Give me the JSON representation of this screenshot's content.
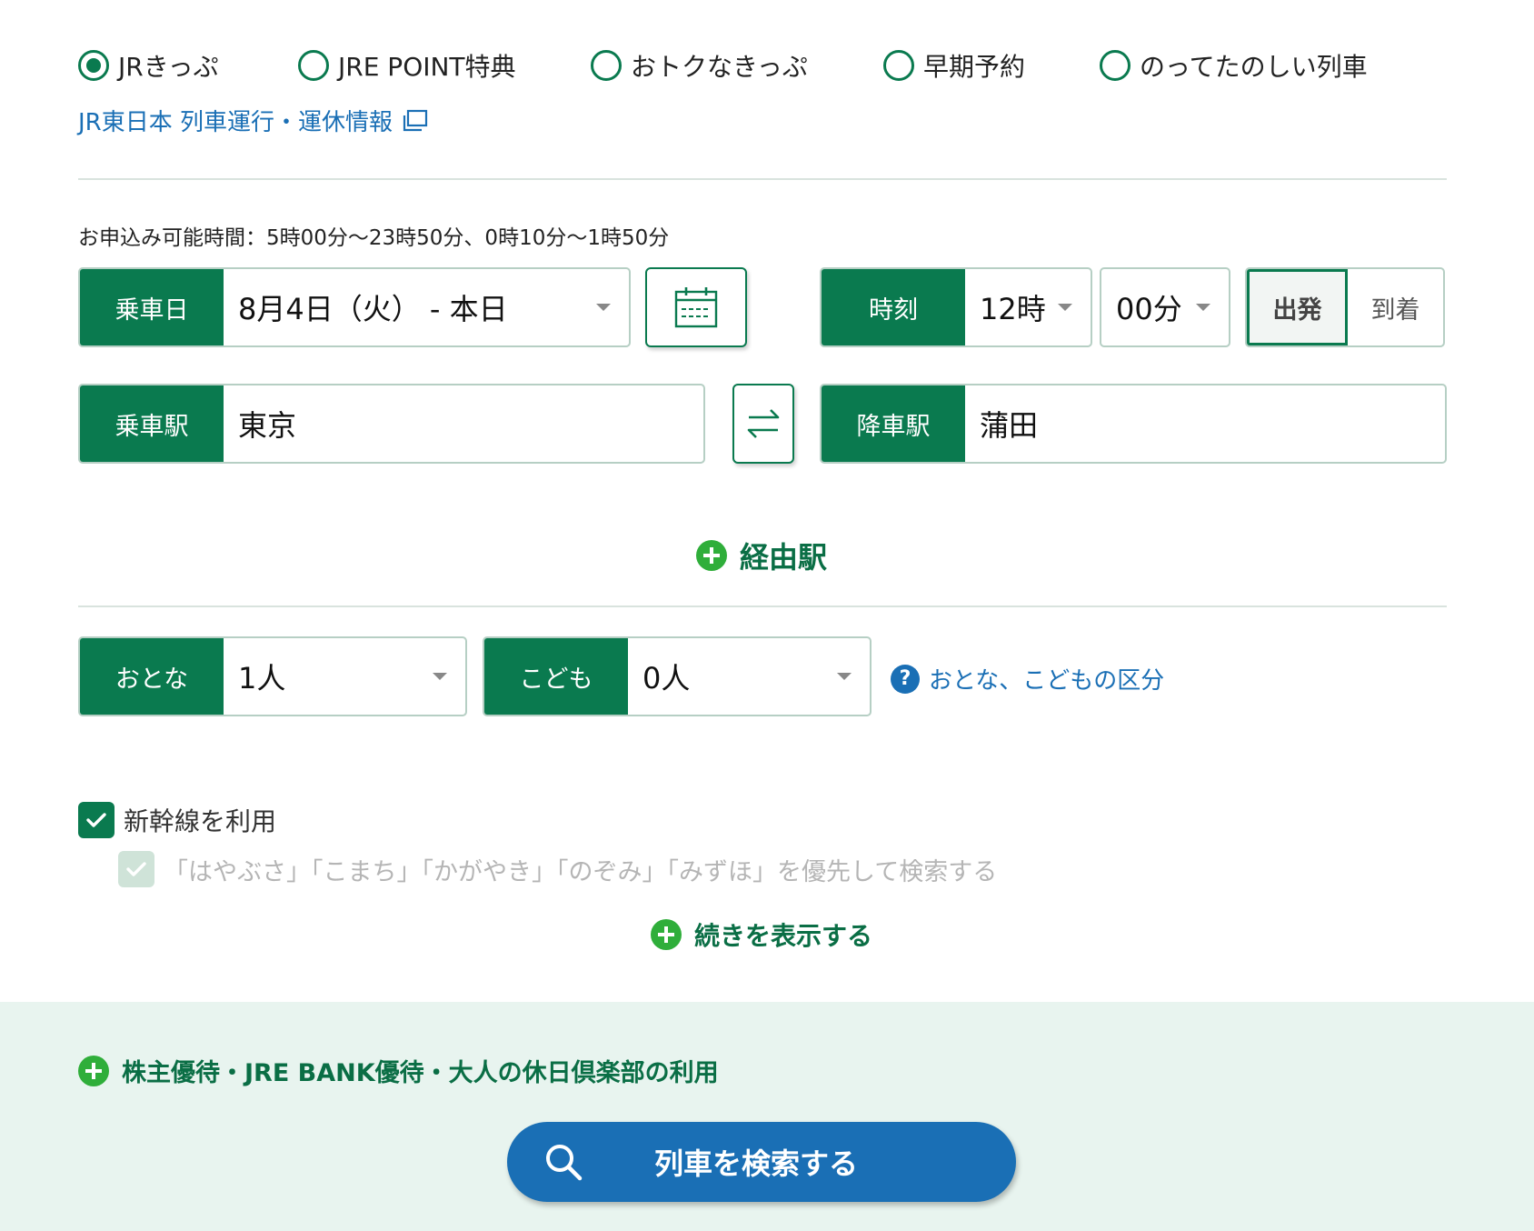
{
  "ticket_types": [
    {
      "label": "JRきっぷ",
      "selected": true
    },
    {
      "label": "JRE POINT特典",
      "selected": false
    },
    {
      "label": "おトクなきっぷ",
      "selected": false
    },
    {
      "label": "早期予約",
      "selected": false
    },
    {
      "label": "のってたのしい列車",
      "selected": false
    }
  ],
  "info_link": "JR東日本 列車運行・運休情報",
  "hours_note": "お申込み可能時間：5時00分〜23時50分、0時10分〜1時50分",
  "date": {
    "label": "乗車日",
    "value": "8月4日（火） - 本日"
  },
  "time": {
    "label": "時刻",
    "hour": "12時",
    "minute": "00分",
    "depart_label": "出発",
    "arrive_label": "到着",
    "selected": "出発"
  },
  "from": {
    "label": "乗車駅",
    "value": "東京"
  },
  "to": {
    "label": "降車駅",
    "value": "蒲田"
  },
  "via_label": "経由駅",
  "adult": {
    "label": "おとな",
    "value": "1人"
  },
  "child": {
    "label": "こども",
    "value": "0人"
  },
  "age_help": "おとな、こどもの区分",
  "shinkansen": {
    "label": "新幹線を利用",
    "checked": true
  },
  "priority": {
    "label": "「はやぶさ」「こまち」「かがやき」「のぞみ」「みずほ」を優先して検索する",
    "checked": true,
    "disabled": true
  },
  "more_label": "続きを表示する",
  "discount_label": "株主優待・JRE BANK優待・大人の休日倶楽部の利用",
  "search_label": "列車を検索する",
  "colors": {
    "primary_green": "#0a7a4f",
    "accent_green": "#2fae3a",
    "link_blue": "#1a6fb5",
    "band": "#e8f4ef"
  }
}
